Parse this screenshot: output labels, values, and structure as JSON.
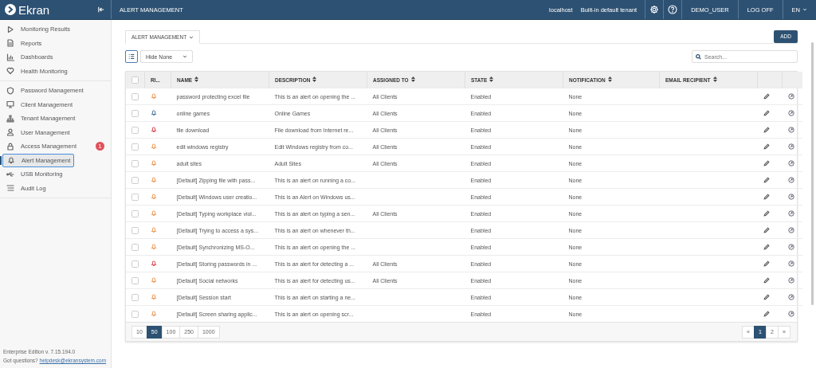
{
  "header": {
    "logo": "Ekran",
    "page_title": "ALERT MANAGEMENT",
    "host": "localhost",
    "tenant": "Built-in default tenant",
    "user": "DEMO_USER",
    "logoff": "LOG OFF",
    "language": "EN"
  },
  "sidebar": {
    "groups": [
      [
        {
          "label": "Monitoring Results",
          "selected": false
        },
        {
          "label": "Reports",
          "selected": false
        },
        {
          "label": "Dashboards",
          "selected": false
        },
        {
          "label": "Health Monitoring",
          "selected": false
        }
      ],
      [
        {
          "label": "Password Management",
          "selected": false
        },
        {
          "label": "Client Management",
          "selected": false
        },
        {
          "label": "Tenant Management",
          "selected": false
        },
        {
          "label": "User Management",
          "selected": false
        },
        {
          "label": "Access Management",
          "selected": false,
          "badge": "1"
        },
        {
          "label": "Alert Management",
          "selected": true
        },
        {
          "label": "USB Monitoring",
          "selected": false
        },
        {
          "label": "Audit Log",
          "selected": false
        }
      ]
    ],
    "footer": {
      "edition": "Enterprise Edition v. 7.15.194.0",
      "question": "Got questions?",
      "email": "helpdesk@ekransystem.com"
    }
  },
  "main": {
    "tab": {
      "label": "ALERT MANAGEMENT"
    },
    "add_button": "ADD",
    "filter": "Hide None",
    "search": {
      "placeholder": "Search..."
    },
    "table": {
      "select_all": {
        "checked": false
      },
      "columns": [
        {
          "label": "RI...",
          "sortable": false
        },
        {
          "label": "NAME",
          "sortable": true
        },
        {
          "label": "DESCRIPTION",
          "sortable": true
        },
        {
          "label": "ASSIGNED TO",
          "sortable": true
        },
        {
          "label": "STATE",
          "sortable": true
        },
        {
          "label": "NOTIFICATION",
          "sortable": true
        },
        {
          "label": "EMAIL RECIPIENT",
          "sortable": true
        }
      ],
      "rows": [
        {
          "checked": false,
          "color": "#f0a060",
          "name": "password protecting excel file",
          "description": "This is an alert on opening the ...",
          "assigned_to": "All Clients",
          "state": "Enabled",
          "notification": "None"
        },
        {
          "checked": false,
          "color": "#5a7fa8",
          "name": "online games",
          "description": "Online Games",
          "assigned_to": "All Clients",
          "state": "Enabled",
          "notification": "None"
        },
        {
          "checked": false,
          "color": "#e0505a",
          "name": "file download",
          "description": "File download from Internet re...",
          "assigned_to": "All Clients",
          "state": "Enabled",
          "notification": "None"
        },
        {
          "checked": false,
          "color": "#f0a060",
          "name": "edit windows registry",
          "description": "Edit Windows registry from co...",
          "assigned_to": "All Clients",
          "state": "Enabled",
          "notification": "None"
        },
        {
          "checked": false,
          "color": "#f0a060",
          "name": "adult sites",
          "description": "Adult Sites",
          "assigned_to": "All Clients",
          "state": "Enabled",
          "notification": "None"
        },
        {
          "checked": false,
          "color": "#f0a060",
          "name": "[Default] Zipping file with pass...",
          "description": "This is an alert on running a co...",
          "state": "Enabled",
          "notification": "None"
        },
        {
          "checked": false,
          "color": "#f0a060",
          "name": "[Default] Windows user creatio...",
          "description": "This is an Alert on Windows us...",
          "state": "Enabled",
          "notification": "None"
        },
        {
          "checked": false,
          "color": "#f0a060",
          "name": "[Default] Typing workplace viol...",
          "description": "This is an alert on typing a sen...",
          "assigned_to": "All Clients",
          "state": "Enabled",
          "notification": "None"
        },
        {
          "checked": false,
          "color": "#f0a060",
          "name": "[Default] Trying to access a sys...",
          "description": "This is an alert on whenever th...",
          "state": "Enabled",
          "notification": "None"
        },
        {
          "checked": false,
          "color": "#f0a060",
          "name": "[Default] Synchronizing MS-O...",
          "description": "This is an alert on opening the ...",
          "state": "Enabled",
          "notification": "None"
        },
        {
          "checked": false,
          "color": "#e0505a",
          "name": "[Default] Storing passwords in ...",
          "description": "This is an alert for detecting a ...",
          "assigned_to": "All Clients",
          "state": "Enabled",
          "notification": "None"
        },
        {
          "checked": false,
          "color": "#f0a060",
          "name": "[Default] Social networks",
          "description": "This is an alert for detecting us...",
          "assigned_to": "All Clients",
          "state": "Enabled",
          "notification": "None"
        },
        {
          "checked": false,
          "color": "#f0a060",
          "name": "[Default] Session start",
          "description": "This is an alert on starting a ne...",
          "state": "Enabled",
          "notification": "None"
        },
        {
          "checked": false,
          "color": "#f0a060",
          "name": "[Default] Screen sharing applic...",
          "description": "This is an alert on opening scr...",
          "state": "Enabled",
          "notification": "None"
        }
      ]
    },
    "page_sizes": [
      {
        "label": "10",
        "selected": false
      },
      {
        "label": "50",
        "selected": true
      },
      {
        "label": "100",
        "selected": false
      },
      {
        "label": "250",
        "selected": false
      },
      {
        "label": "1000",
        "selected": false
      }
    ],
    "pages": [
      {
        "label": "«",
        "selected": false
      },
      {
        "label": "1",
        "selected": true
      },
      {
        "label": "2",
        "selected": false
      },
      {
        "label": "»",
        "selected": false
      }
    ]
  }
}
